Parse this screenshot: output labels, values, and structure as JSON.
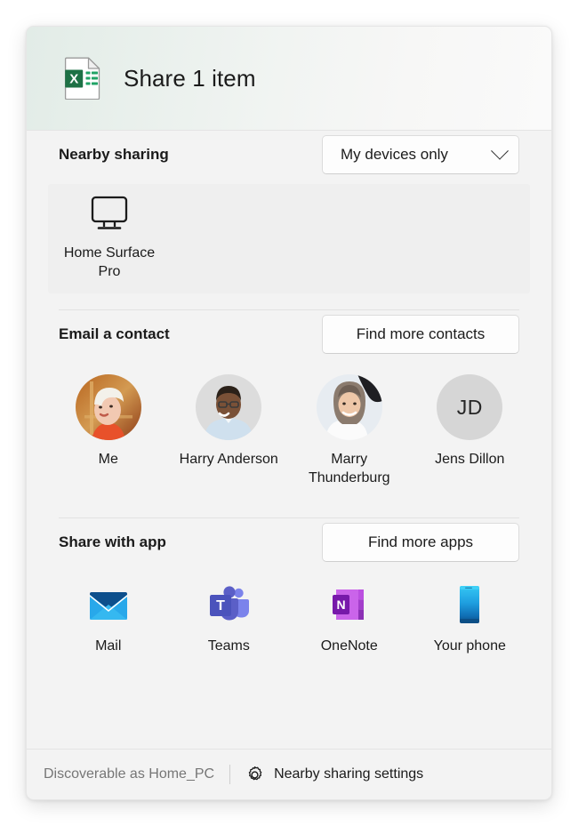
{
  "dialog": {
    "title": "Share 1 item",
    "file_icon": "excel-file-icon"
  },
  "nearby_sharing": {
    "title": "Nearby sharing",
    "dropdown": {
      "selected": "My devices only",
      "icon": "chevron-down-icon"
    },
    "devices": [
      {
        "name": "Home Surface\nPro",
        "label": "Home Surface Pro",
        "icon": "monitor-icon"
      }
    ]
  },
  "email_contact": {
    "title": "Email a contact",
    "find_more_label": "Find more contacts",
    "contacts": [
      {
        "label": "Me",
        "avatar_type": "photo",
        "avatar_style": "blonde-woman"
      },
      {
        "label": "Harry Anderson",
        "avatar_type": "photo",
        "avatar_style": "man-blue-shirt"
      },
      {
        "label": "Marry Thunderburg",
        "avatar_type": "photo",
        "avatar_style": "woman-hijab"
      },
      {
        "label": "Jens Dillon",
        "avatar_type": "initials",
        "initials": "JD"
      }
    ]
  },
  "share_with_app": {
    "title": "Share with app",
    "find_more_label": "Find more apps",
    "apps": [
      {
        "label": "Mail",
        "icon": "mail-icon"
      },
      {
        "label": "Teams",
        "icon": "teams-icon"
      },
      {
        "label": "OneNote",
        "icon": "onenote-icon"
      },
      {
        "label": "Your phone",
        "icon": "your-phone-icon"
      }
    ]
  },
  "footer": {
    "discoverable_text": "Discoverable as Home_PC",
    "settings_label": "Nearby sharing settings",
    "settings_icon": "gear-icon"
  },
  "colors": {
    "excel_green": "#1d7145",
    "mail_blue": "#0f78d4",
    "teams_purple": "#5b5fc7",
    "onenote_purple": "#7719aa",
    "phone_blue": "#2bb3e8",
    "surface": "#f3f3f3",
    "header_tint": "#e2ece7"
  }
}
